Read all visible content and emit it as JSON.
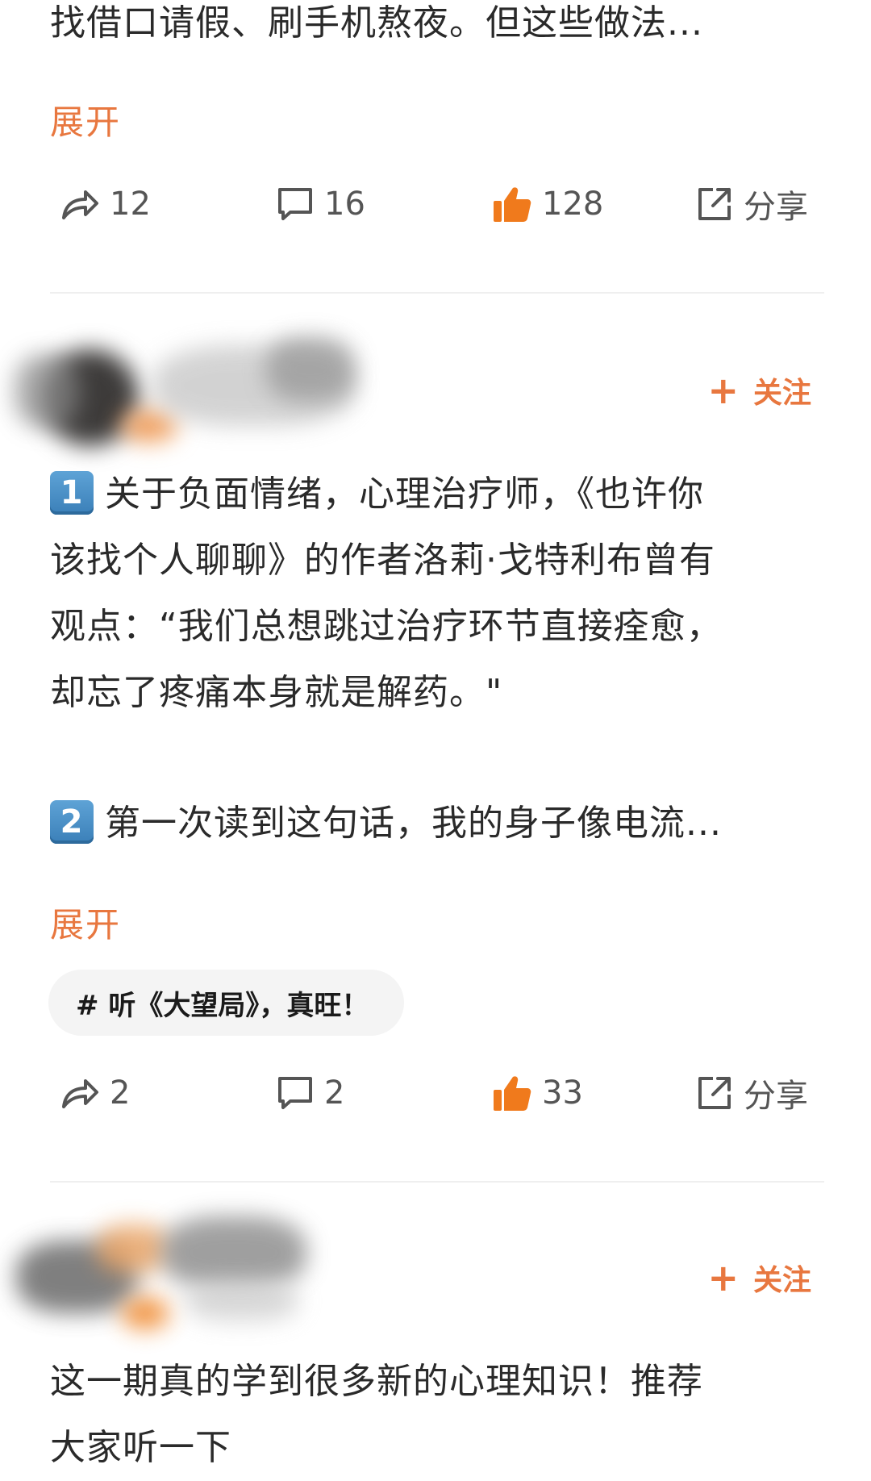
{
  "post1": {
    "text_last_line": "找借口请假、刷手机熬夜。但这些做法...",
    "expand_label": "展开",
    "actions": {
      "repost_count": "12",
      "comment_count": "16",
      "like_count": "128",
      "share_label": "分享"
    }
  },
  "post2": {
    "follow_label": "关注",
    "paragraph1": {
      "number": "1",
      "lines": [
        "关于负面情绪，心理治疗师，《也许你",
        "该找个人聊聊》的作者洛莉·戈特利布曾有",
        "观点：“我们总想跳过治疗环节直接痊愈，",
        "却忘了疼痛本身就是解药。\""
      ]
    },
    "paragraph2": {
      "number": "2",
      "line": "第一次读到这句话，我的身子像电流..."
    },
    "expand_label": "展开",
    "topic": "# 听《大望局》，真旺！",
    "actions": {
      "repost_count": "2",
      "comment_count": "2",
      "like_count": "33",
      "share_label": "分享"
    }
  },
  "post3": {
    "follow_label": "关注",
    "lines": [
      "这一期真的学到很多新的心理知识！推荐",
      "大家听一下"
    ]
  },
  "colors": {
    "accent": "#e8773f",
    "like": "#f07a1c",
    "text": "#2a2a2a",
    "muted": "#555555",
    "keycap": "#4a90c8"
  },
  "icons": {
    "repost": "repost-arrow-icon",
    "comment": "comment-bubble-icon",
    "like": "thumbs-up-icon",
    "share": "share-external-icon",
    "follow": "plus-icon"
  }
}
